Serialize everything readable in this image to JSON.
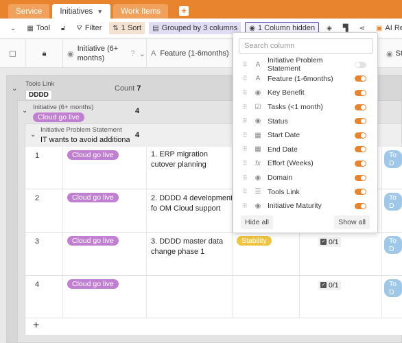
{
  "tabs": [
    {
      "label": "Service"
    },
    {
      "label": "Initiatives"
    },
    {
      "label": "Work Items"
    }
  ],
  "toolbar": {
    "tool": "Tool",
    "filter": "Filter",
    "sort": "1 Sort",
    "grouped": "Grouped by 3 columns",
    "hidden": "1 Column hidden",
    "ai_report": "AI Repor"
  },
  "columns": {
    "initiative": "Initiative (6+ months)",
    "feature": "Feature (1-6months)",
    "partial": "St"
  },
  "group1": {
    "label": "Tools Link",
    "value": "DDDD",
    "count_label": "Count",
    "count": "7"
  },
  "group2": {
    "label": "Initiative (6+ months)",
    "value": "Cloud go live",
    "count": "4"
  },
  "group3": {
    "label": "Initiative Problem Statement",
    "value": "IT wants to avoid additional",
    "count": "4"
  },
  "rows": [
    {
      "num": "1",
      "initiative": "Cloud go live",
      "feature": "1. ERP migration cutover planning",
      "key": "",
      "tasks": "",
      "status": "To D"
    },
    {
      "num": "2",
      "initiative": "Cloud go live",
      "feature": "2. DDDD 4 development fo OM Cloud support",
      "key": "",
      "tasks": "",
      "status": "To D"
    },
    {
      "num": "3",
      "initiative": "Cloud go live",
      "feature": "3. DDDD master data change phase 1",
      "key": "Stability",
      "tasks": "0/1",
      "status": "To D"
    },
    {
      "num": "4",
      "initiative": "Cloud go live",
      "feature": "",
      "key": "",
      "tasks": "0/1",
      "status": "To D"
    }
  ],
  "add_row": "+",
  "popup": {
    "search_placeholder": "Search column",
    "items": [
      {
        "label": "Initiative Problem Statement",
        "icon": "text-icon",
        "on": false
      },
      {
        "label": "Feature (1-6months)",
        "icon": "text-icon",
        "on": true
      },
      {
        "label": "Key Benefit",
        "icon": "select-icon",
        "on": true
      },
      {
        "label": "Tasks (<1 month)",
        "icon": "checklist-icon",
        "on": true
      },
      {
        "label": "Status",
        "icon": "select-icon",
        "on": true
      },
      {
        "label": "Start Date",
        "icon": "calendar-icon",
        "on": true
      },
      {
        "label": "End Date",
        "icon": "calendar-icon",
        "on": true
      },
      {
        "label": "Effort (Weeks)",
        "icon": "formula-icon",
        "on": true
      },
      {
        "label": "Domain",
        "icon": "select-icon",
        "on": true
      },
      {
        "label": "Tools Link",
        "icon": "link-icon",
        "on": true
      },
      {
        "label": "Initiative Maturity",
        "icon": "select-icon",
        "on": true
      }
    ],
    "hide_all": "Hide all",
    "show_all": "Show all"
  },
  "colors": {
    "accent": "#e9842e",
    "pill_purple": "#c17fd1",
    "pill_yellow": "#f0c440",
    "todo_blue": "#9fc8e8"
  }
}
